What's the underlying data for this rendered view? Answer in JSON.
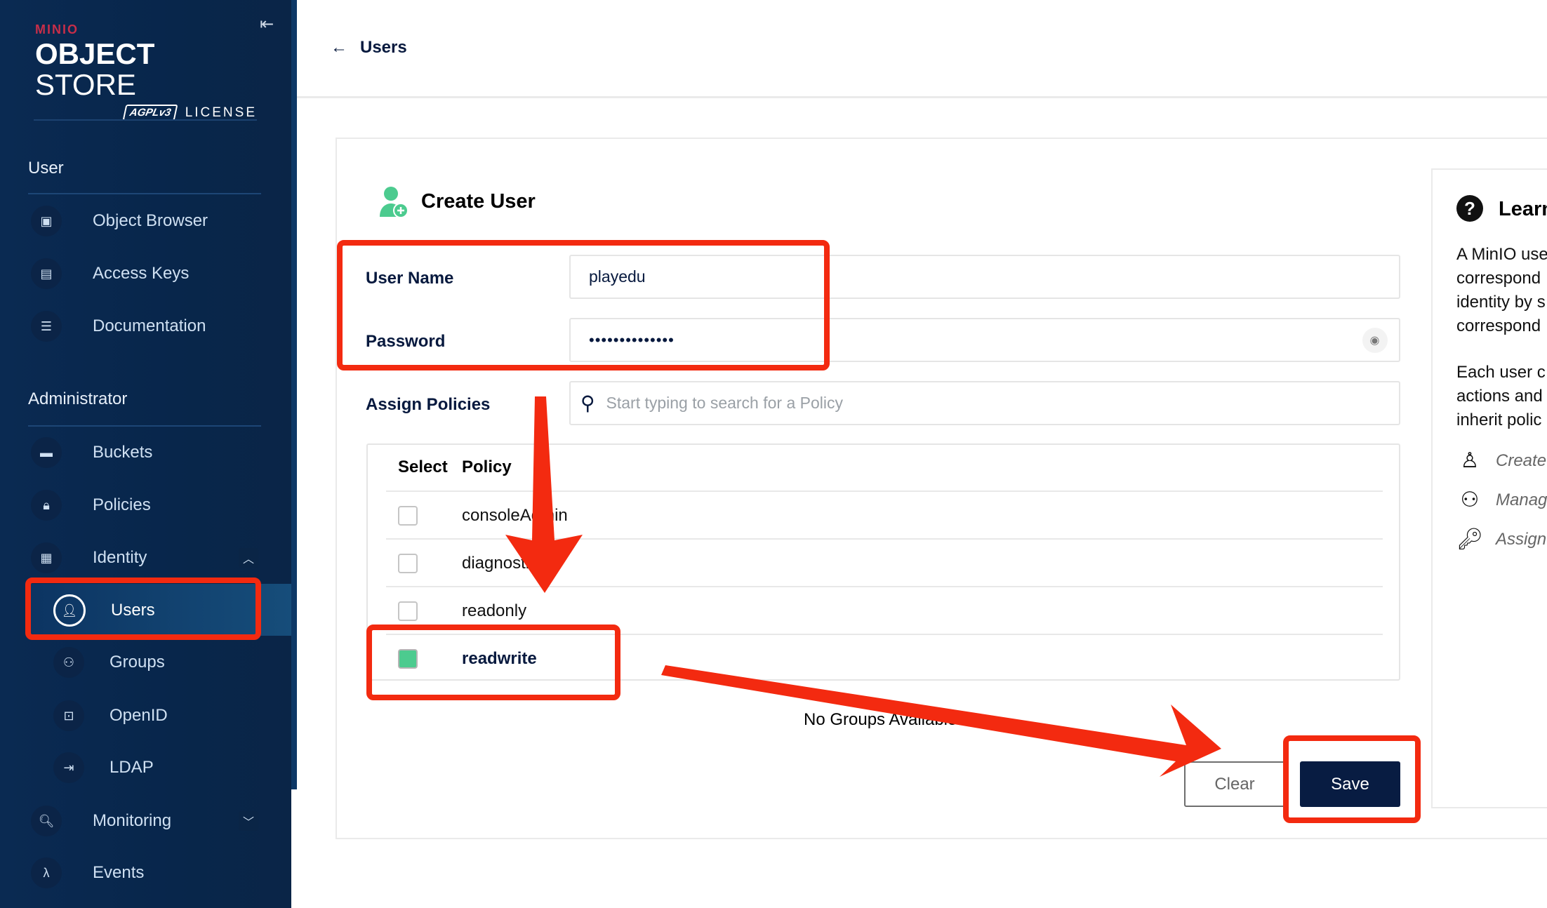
{
  "sidebar": {
    "logo": {
      "brand": "MINIO",
      "product_bold": "OBJECT",
      "product_light": "STORE",
      "license_badge": "AGPLv3",
      "license_text": "LICENSE"
    },
    "collapse_icon": "collapse-left-icon",
    "sections": [
      {
        "title": "User",
        "items": [
          {
            "label": "Object Browser",
            "icon": "object-browser-icon"
          },
          {
            "label": "Access Keys",
            "icon": "access-keys-icon"
          },
          {
            "label": "Documentation",
            "icon": "documentation-icon"
          }
        ]
      },
      {
        "title": "Administrator",
        "items": [
          {
            "label": "Buckets",
            "icon": "bucket-icon"
          },
          {
            "label": "Policies",
            "icon": "policy-lock-icon"
          },
          {
            "label": "Identity",
            "icon": "identity-card-icon",
            "expanded": true,
            "children": [
              {
                "label": "Users",
                "icon": "user-circle-icon",
                "active": true
              },
              {
                "label": "Groups",
                "icon": "groups-icon"
              },
              {
                "label": "OpenID",
                "icon": "openid-lock-icon"
              },
              {
                "label": "LDAP",
                "icon": "ldap-login-icon"
              }
            ]
          },
          {
            "label": "Monitoring",
            "icon": "monitoring-icon",
            "expanded": false
          },
          {
            "label": "Events",
            "icon": "lambda-icon"
          }
        ]
      }
    ]
  },
  "header": {
    "back_label": "Users"
  },
  "form": {
    "title": "Create User",
    "username": {
      "label": "User Name",
      "value": "playedu"
    },
    "password": {
      "label": "Password",
      "value": "••••••••••••••"
    },
    "policies": {
      "label": "Assign Policies",
      "search_placeholder": "Start typing to search for a Policy",
      "columns": [
        "Select",
        "Policy"
      ],
      "rows": [
        {
          "name": "consoleAdmin",
          "selected": false
        },
        {
          "name": "diagnostics",
          "selected": false
        },
        {
          "name": "readonly",
          "selected": false
        },
        {
          "name": "readwrite",
          "selected": true
        }
      ]
    },
    "groups_empty": "No Groups Available",
    "clear_label": "Clear",
    "save_label": "Save"
  },
  "learn": {
    "title": "Learn",
    "para1": "A MinIO user\ncorrespond\nidentity by s\ncorrespond",
    "para2": "Each user c\nactions and\ninherit polic",
    "items": [
      {
        "icon": "user-outline-icon",
        "text": "Create"
      },
      {
        "icon": "group-outline-icon",
        "text": "Manag"
      },
      {
        "icon": "key-icon",
        "text": "Assign"
      }
    ]
  },
  "colors": {
    "sidebar_bg": "#0a2a52",
    "accent_green": "#4ccb8f",
    "primary_button": "#081c42",
    "annotation_red": "#f32a10"
  }
}
